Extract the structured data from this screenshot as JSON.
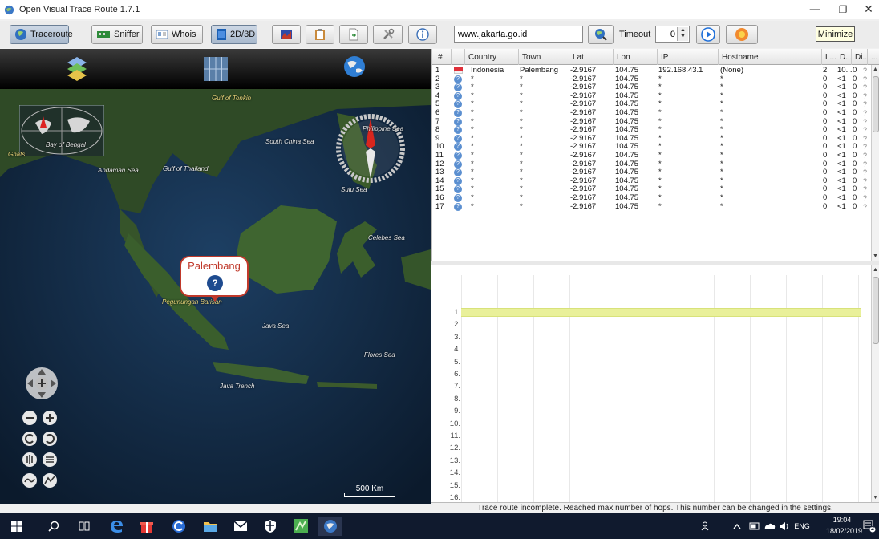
{
  "window": {
    "title": "Open Visual Trace Route 1.7.1",
    "minimize_glyph": "—",
    "maximize_glyph": "❐",
    "close_glyph": "✕"
  },
  "toolbar": {
    "traceroute_label": "Traceroute",
    "sniffer_label": "Sniffer",
    "whois_label": "Whois",
    "mode_label": "2D/3D",
    "url_value": "www.jakarta.go.id",
    "timeout_label": "Timeout",
    "timeout_value": "0",
    "tooltip": "Minimize"
  },
  "map": {
    "labels": [
      {
        "text": "Gulf of Tonkin",
        "kind": "gulf"
      },
      {
        "text": "South China Sea",
        "kind": "sea"
      },
      {
        "text": "Philippine Sea",
        "kind": "sea"
      },
      {
        "text": "Bay of Bengal",
        "kind": "sea"
      },
      {
        "text": "Ghats",
        "kind": "gulf"
      },
      {
        "text": "Andaman Sea",
        "kind": "sea"
      },
      {
        "text": "Gulf of Thailand",
        "kind": "sea"
      },
      {
        "text": "Sulu Sea",
        "kind": "sea"
      },
      {
        "text": "Celebes Sea",
        "kind": "sea"
      },
      {
        "text": "Pegunungan Barisan",
        "kind": "gulf"
      },
      {
        "text": "Java Sea",
        "kind": "sea"
      },
      {
        "text": "Flores Sea",
        "kind": "sea"
      },
      {
        "text": "Java Trench",
        "kind": "sea"
      }
    ],
    "callout_title": "Palembang",
    "callout_icon": "?",
    "scale_label": "500 Km"
  },
  "table": {
    "columns": [
      "#",
      "",
      "Country",
      "Town",
      "Lat",
      "Lon",
      "IP",
      "Hostname",
      "L...",
      "D...",
      "Di...",
      "..."
    ],
    "rows": [
      [
        "1",
        "flag",
        "Indonesia",
        "Palembang",
        "-2.9167",
        "104.75",
        "192.168.43.1",
        "(None)",
        "2",
        "10...",
        "0"
      ],
      [
        "2",
        "q",
        "*",
        "*",
        "-2.9167",
        "104.75",
        "*",
        "*",
        "0",
        "<1",
        "0"
      ],
      [
        "3",
        "q",
        "*",
        "*",
        "-2.9167",
        "104.75",
        "*",
        "*",
        "0",
        "<1",
        "0"
      ],
      [
        "4",
        "q",
        "*",
        "*",
        "-2.9167",
        "104.75",
        "*",
        "*",
        "0",
        "<1",
        "0"
      ],
      [
        "5",
        "q",
        "*",
        "*",
        "-2.9167",
        "104.75",
        "*",
        "*",
        "0",
        "<1",
        "0"
      ],
      [
        "6",
        "q",
        "*",
        "*",
        "-2.9167",
        "104.75",
        "*",
        "*",
        "0",
        "<1",
        "0"
      ],
      [
        "7",
        "q",
        "*",
        "*",
        "-2.9167",
        "104.75",
        "*",
        "*",
        "0",
        "<1",
        "0"
      ],
      [
        "8",
        "q",
        "*",
        "*",
        "-2.9167",
        "104.75",
        "*",
        "*",
        "0",
        "<1",
        "0"
      ],
      [
        "9",
        "q",
        "*",
        "*",
        "-2.9167",
        "104.75",
        "*",
        "*",
        "0",
        "<1",
        "0"
      ],
      [
        "10",
        "q",
        "*",
        "*",
        "-2.9167",
        "104.75",
        "*",
        "*",
        "0",
        "<1",
        "0"
      ],
      [
        "11",
        "q",
        "*",
        "*",
        "-2.9167",
        "104.75",
        "*",
        "*",
        "0",
        "<1",
        "0"
      ],
      [
        "12",
        "q",
        "*",
        "*",
        "-2.9167",
        "104.75",
        "*",
        "*",
        "0",
        "<1",
        "0"
      ],
      [
        "13",
        "q",
        "*",
        "*",
        "-2.9167",
        "104.75",
        "*",
        "*",
        "0",
        "<1",
        "0"
      ],
      [
        "14",
        "q",
        "*",
        "*",
        "-2.9167",
        "104.75",
        "*",
        "*",
        "0",
        "<1",
        "0"
      ],
      [
        "15",
        "q",
        "*",
        "*",
        "-2.9167",
        "104.75",
        "*",
        "*",
        "0",
        "<1",
        "0"
      ],
      [
        "16",
        "q",
        "*",
        "*",
        "-2.9167",
        "104.75",
        "*",
        "*",
        "0",
        "<1",
        "0"
      ],
      [
        "17",
        "q",
        "*",
        "*",
        "-2.9167",
        "104.75",
        "*",
        "*",
        "0",
        "<1",
        "0"
      ]
    ]
  },
  "gantt": {
    "row_labels": [
      "1.",
      "2.",
      "3.",
      "4.",
      "5.",
      "6.",
      "7.",
      "8.",
      "9.",
      "10.",
      "11.",
      "12.",
      "13.",
      "14.",
      "15.",
      "16."
    ]
  },
  "status": "Trace route incomplete. Reached max number of hops. This number can be changed in the settings.",
  "taskbar": {
    "language": "ENG",
    "time": "19:04",
    "date": "18/02/2019",
    "notification_count": "2"
  },
  "colors": {
    "accent": "#1e6fd9",
    "callout_border": "#c0392b",
    "gantt_bar": "#e9f09a",
    "taskbar": "#101a2e"
  }
}
